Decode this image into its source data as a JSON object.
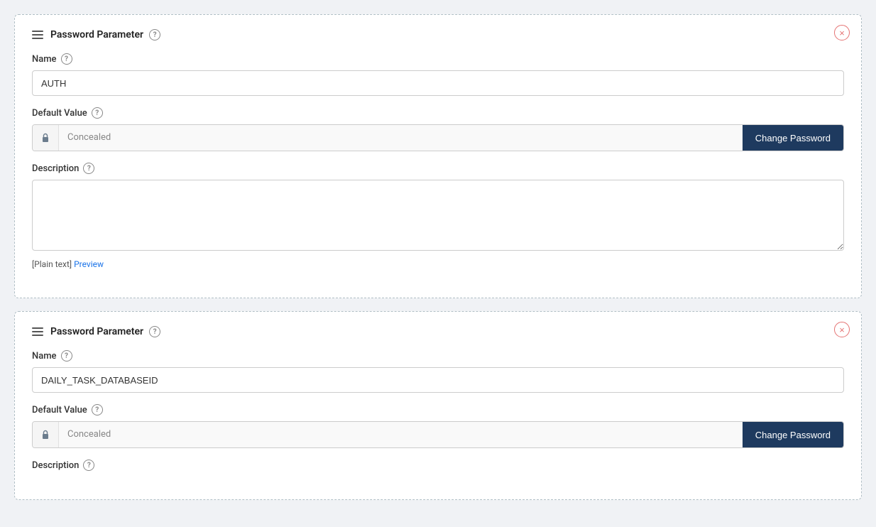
{
  "cards": [
    {
      "id": "card-1",
      "title": "Password Parameter",
      "name_label": "Name",
      "name_value": "AUTH",
      "default_value_label": "Default Value",
      "concealed_text": "Concealed",
      "change_password_label": "Change Password",
      "description_label": "Description",
      "description_value": "",
      "preview_text": "[Plain text]",
      "preview_link_text": "Preview"
    },
    {
      "id": "card-2",
      "title": "Password Parameter",
      "name_label": "Name",
      "name_value": "DAILY_TASK_DATABASEID",
      "default_value_label": "Default Value",
      "concealed_text": "Concealed",
      "change_password_label": "Change Password",
      "description_label": "Description",
      "description_value": "",
      "preview_text": "",
      "preview_link_text": ""
    }
  ],
  "icons": {
    "help": "?",
    "close": "×"
  }
}
